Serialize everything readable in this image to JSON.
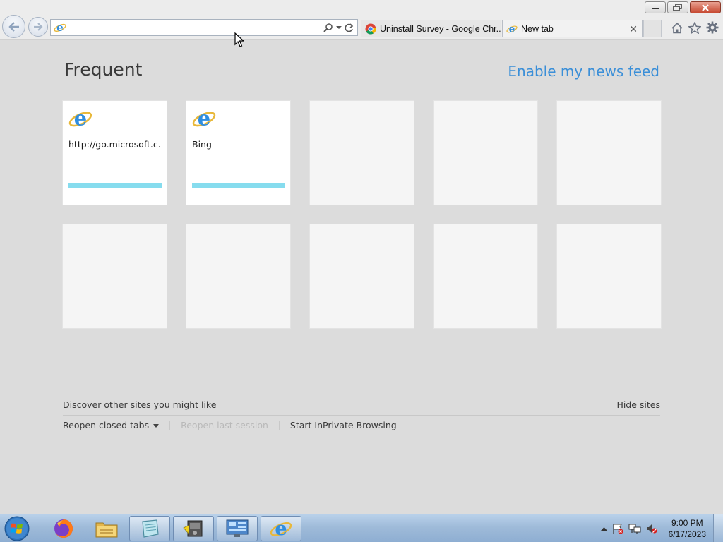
{
  "browser": {
    "address": {
      "value": "",
      "placeholder": ""
    },
    "tabs": [
      {
        "label": "Uninstall Survey - Google Chr...",
        "icon": "chrome-icon",
        "active": false
      },
      {
        "label": "New tab",
        "icon": "ie-icon",
        "active": true
      }
    ],
    "tab_close_glyph": "✕"
  },
  "page": {
    "heading": "Frequent",
    "news_feed_link": "Enable my news feed",
    "tiles": [
      {
        "label": "http://go.microsoft.c...",
        "icon": "ie-icon"
      },
      {
        "label": "Bing",
        "icon": "ie-icon"
      },
      {
        "label": ""
      },
      {
        "label": ""
      },
      {
        "label": ""
      },
      {
        "label": ""
      },
      {
        "label": ""
      },
      {
        "label": ""
      },
      {
        "label": ""
      },
      {
        "label": ""
      }
    ],
    "discover": "Discover other sites you might like",
    "hide_sites": "Hide sites",
    "reopen_closed_tabs": "Reopen closed tabs",
    "reopen_last_session": "Reopen last session",
    "start_inprivate": "Start InPrivate Browsing"
  },
  "taskbar": {
    "apps": [
      "firefox-icon",
      "file-explorer-icon",
      "notepad-icon",
      "media-app-icon",
      "control-panel-icon",
      "ie-icon"
    ],
    "time": "9:00 PM",
    "date": "6/17/2023"
  },
  "colors": {
    "accent_link": "#3b8fd8",
    "tile_bar": "#86dcee",
    "page_bg": "#dcdcdc"
  }
}
